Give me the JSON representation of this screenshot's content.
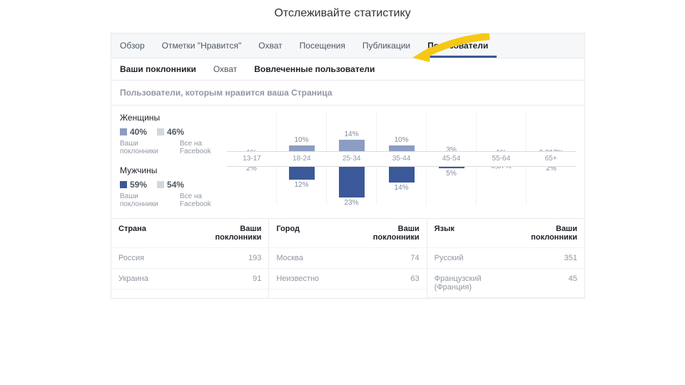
{
  "slide_title": "Отслеживайте статистику",
  "tabs": [
    "Обзор",
    "Отметки \"Нравится\"",
    "Охват",
    "Посещения",
    "Публикации",
    "Пользователи"
  ],
  "active_tab_index": 5,
  "subtabs": [
    "Ваши поклонники",
    "Охват",
    "Вовлеченные пользователи"
  ],
  "section_title": "Пользователи, которым нравится ваша Страница",
  "gender": {
    "women": {
      "label": "Женщины",
      "yours_pct": "40%",
      "all_pct": "46%",
      "yours_label": "Ваши поклонники",
      "all_label": "Все на Facebook",
      "yours_sw": "#8b9dc3",
      "all_sw": "#d3d6db"
    },
    "men": {
      "label": "Мужчины",
      "yours_pct": "59%",
      "all_pct": "54%",
      "yours_label": "Ваши поклонники",
      "all_label": "Все на Facebook",
      "yours_sw": "#3b5998",
      "all_sw": "#d3d6db"
    }
  },
  "tables": {
    "country": {
      "head_left": "Страна",
      "head_right": "Ваши поклонники",
      "rows": [
        {
          "l": "Россия",
          "r": "193"
        },
        {
          "l": "Украина",
          "r": "91"
        }
      ]
    },
    "city": {
      "head_left": "Город",
      "head_right": "Ваши поклонники",
      "rows": [
        {
          "l": "Москва",
          "r": "74"
        },
        {
          "l": "Неизвестно",
          "r": "63"
        }
      ]
    },
    "lang": {
      "head_left": "Язык",
      "head_right": "Ваши поклонники",
      "rows": [
        {
          "l": "Русский",
          "r": "351"
        },
        {
          "l": "Французский (Франция)",
          "r": "45"
        }
      ]
    }
  },
  "chart_data": {
    "type": "bar",
    "categories": [
      "13-17",
      "18-24",
      "25-34",
      "35-44",
      "45-54",
      "55-64",
      "65+"
    ],
    "series": [
      {
        "name": "Женщины",
        "values_pct": [
          1,
          10,
          14,
          10,
          3,
          1,
          0.217
        ],
        "labels": [
          "1%",
          "10%",
          "14%",
          "10%",
          "3%",
          "1%",
          "0,217%"
        ],
        "color": "#8b9dc3"
      },
      {
        "name": "Мужчины",
        "values_pct": [
          2,
          12,
          23,
          14,
          5,
          0.87,
          2
        ],
        "labels": [
          "2%",
          "12%",
          "23%",
          "14%",
          "5%",
          "0,87%",
          "2%"
        ],
        "color": "#3b5998"
      }
    ],
    "ylim": [
      0,
      25
    ],
    "xlabel": "",
    "ylabel": ""
  }
}
